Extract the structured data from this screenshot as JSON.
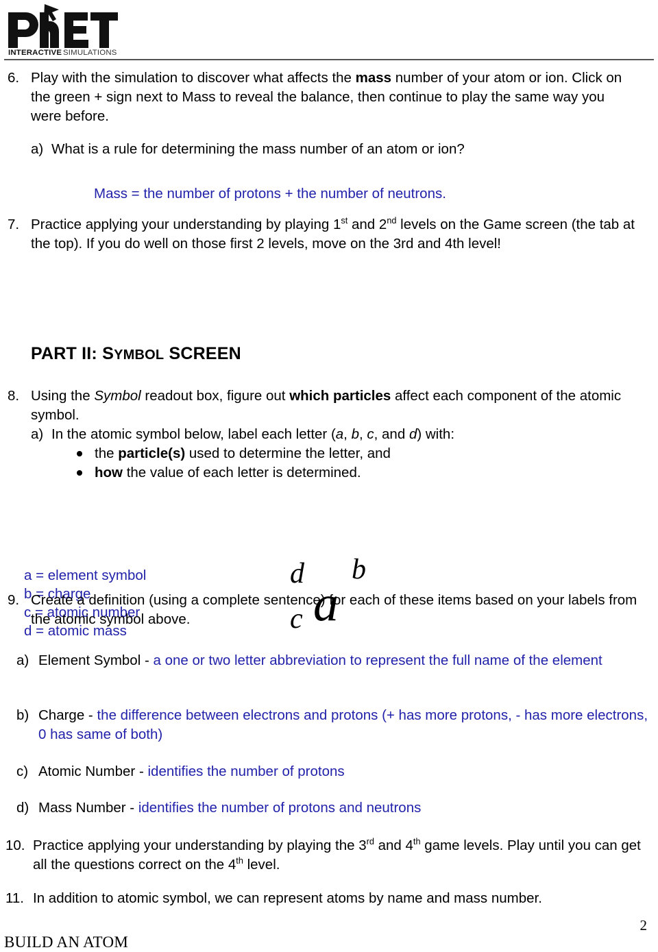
{
  "header": {
    "logo_text": "PhET",
    "logo_subtitle": "INTERACTIVE SIMULATIONS",
    "logo_icon": "cursor-arrow-icon"
  },
  "item6": {
    "number": "6.",
    "text_part1": "Play with the simulation to discover what affects the ",
    "bold1": "mass",
    "text_part2": " number of your atom or ion.  Click on the green + sign next to Mass to reveal the balance, then continue to play the same way you were before."
  },
  "item6a": {
    "label": "a)",
    "text": "What is a rule for determining the mass number of an atom or ion?"
  },
  "answer6": {
    "text": "Mass = the number of protons + the number of neutrons."
  },
  "item7": {
    "number": "7.",
    "text_part1": "Practice applying your understanding by playing 1",
    "sup1": "st",
    "text_part2": " and 2",
    "sup2": "nd",
    "text_part3": " levels on the Game screen (the tab at the top).  If you do well on those first 2 levels, move on the 3rd and 4th level!"
  },
  "part2": {
    "prefix": "PART II: ",
    "smallcaps_cap": "S",
    "smallcaps_rest": "YMBOL",
    "suffix": " SCREEN"
  },
  "item8": {
    "number": "8.",
    "text_part1": "Using the ",
    "italic1": "Symbol",
    "text_part2": " readout box, figure out ",
    "bold1": "which particles",
    "text_part3": " affect each component of the atomic symbol."
  },
  "item8a": {
    "label": "a)",
    "text_part1": "In the atomic symbol below, label each letter (",
    "i_a": "a",
    "sep1": ", ",
    "i_b": "b",
    "sep2": ", ",
    "i_c": "c",
    "sep3": ", and ",
    "i_d": "d",
    "text_part2": ") with:"
  },
  "bullets": [
    {
      "pre": "the ",
      "bold": "particle(s)",
      "post": " used to determine the letter, and"
    },
    {
      "pre": "",
      "bold": "how",
      "post": " the value of each letter is determined."
    }
  ],
  "legend": {
    "lines": [
      "a = element symbol",
      "b = charge",
      "c = atomic number",
      "d = atomic mass"
    ],
    "color": "#2222aa"
  },
  "atomic_symbol": {
    "center": "a",
    "upper_left": "d",
    "upper_right": "b",
    "lower_left": "c"
  },
  "item9": {
    "number": "9.",
    "text": "Create a definition (using a complete sentence) for each of these items based on your labels from the atomic symbol above."
  },
  "item9a": {
    "label": "a)",
    "black": "Element Symbol - ",
    "blue": "a one or two letter abbreviation to represent the full name of the element"
  },
  "item9b": {
    "label": "b)",
    "black": "Charge - ",
    "blue": "the difference between electrons and protons (+ has more protons, -  has more electrons, 0 has same of both)"
  },
  "item9c": {
    "label": "c)",
    "black": "Atomic Number - ",
    "blue": "identifies the number of protons"
  },
  "item9d": {
    "label": "d)",
    "black": "Mass Number - ",
    "blue": "identifies the number of protons and neutrons"
  },
  "item10": {
    "number": "10.",
    "text_part1": "Practice applying your understanding by playing the 3",
    "sup1": "rd",
    "text_part2": " and 4",
    "sup2": "th",
    "text_part3": " game levels.  Play until you can get all the questions correct on the 4",
    "sup3": "th",
    "text_part4": " level."
  },
  "item11": {
    "number": "11.",
    "text": "In addition to atomic symbol, we can represent atoms by name and mass number."
  },
  "footer": {
    "page_number": "2",
    "title": "BUILD AN ATOM"
  }
}
